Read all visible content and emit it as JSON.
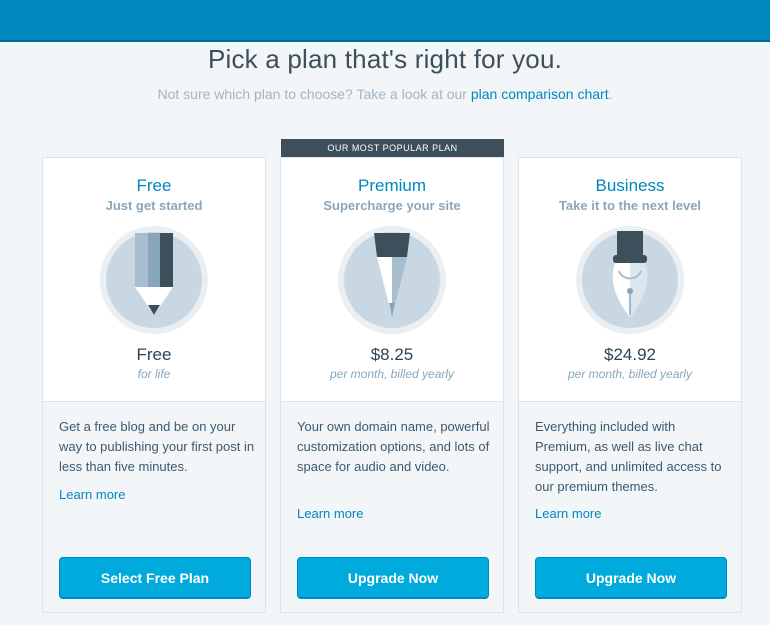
{
  "header": {
    "title": "Pick a plan that's right for you.",
    "subtitle_prefix": "Not sure which plan to choose? Take a look at our ",
    "subtitle_link": "plan comparison chart",
    "subtitle_suffix": "."
  },
  "popular_badge": "OUR MOST POPULAR PLAN",
  "plans": [
    {
      "name": "Free",
      "tagline": "Just get started",
      "icon": "pencil-icon",
      "price": "Free",
      "period": "for life",
      "description": "Get a free blog and be on your way to publishing your first post in less than five minutes.",
      "learn_more": "Learn more",
      "button": "Select Free Plan"
    },
    {
      "name": "Premium",
      "tagline": "Supercharge your site",
      "icon": "pen-icon",
      "price": "$8.25",
      "period": "per month, billed yearly",
      "description": "Your own domain name, powerful customization options, and lots of space for audio and video.",
      "learn_more": "Learn more",
      "button": "Upgrade Now"
    },
    {
      "name": "Business",
      "tagline": "Take it to the next level",
      "icon": "fountain-pen-icon",
      "price": "$24.92",
      "period": "per month, billed yearly",
      "description": "Everything included with Premium, as well as live chat support, and unlimited access to our premium themes.",
      "learn_more": "Learn more",
      "button": "Upgrade Now"
    }
  ],
  "colors": {
    "topbar": "#0087be",
    "accent": "#0087be",
    "button": "#00aadc",
    "badge": "#3d4f5b",
    "background": "#f3f6f8"
  }
}
